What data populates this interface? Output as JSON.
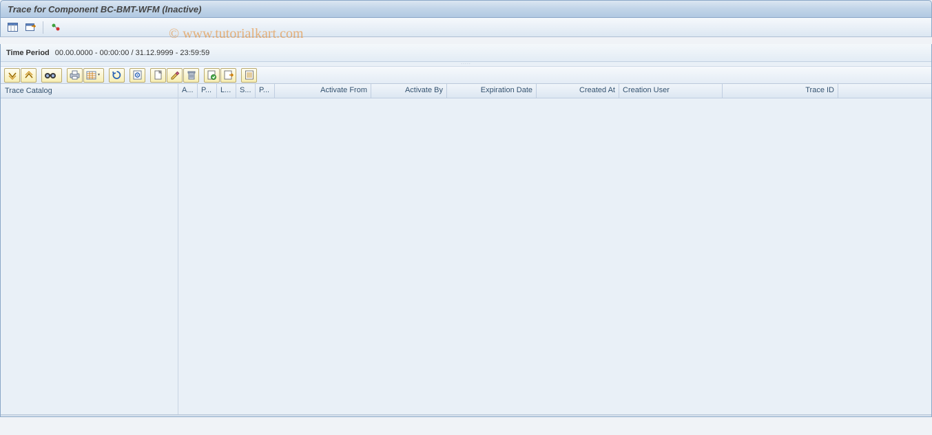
{
  "title": "Trace for Component BC-BMT-WFM (Inactive)",
  "watermark": "© www.tutorialkart.com",
  "appToolbar": {
    "btn1": "layout-icon",
    "btn2": "refresh-screen-icon",
    "btn3": "activate-trace-icon"
  },
  "timePeriod": {
    "label": "Time Period",
    "value": "00.00.0000 - 00:00:00 / 31.12.9999 - 23:59:59"
  },
  "columns": {
    "treeHeader": "Trace Catalog",
    "c1": "A...",
    "c2": "P...",
    "c3": "L...",
    "c4": "S...",
    "c5": "P...",
    "c6": "Activate From",
    "c7": "Activate By",
    "c8": "Expiration Date",
    "c9": "Created At",
    "c10": "Creation User",
    "c11": "Trace ID"
  }
}
